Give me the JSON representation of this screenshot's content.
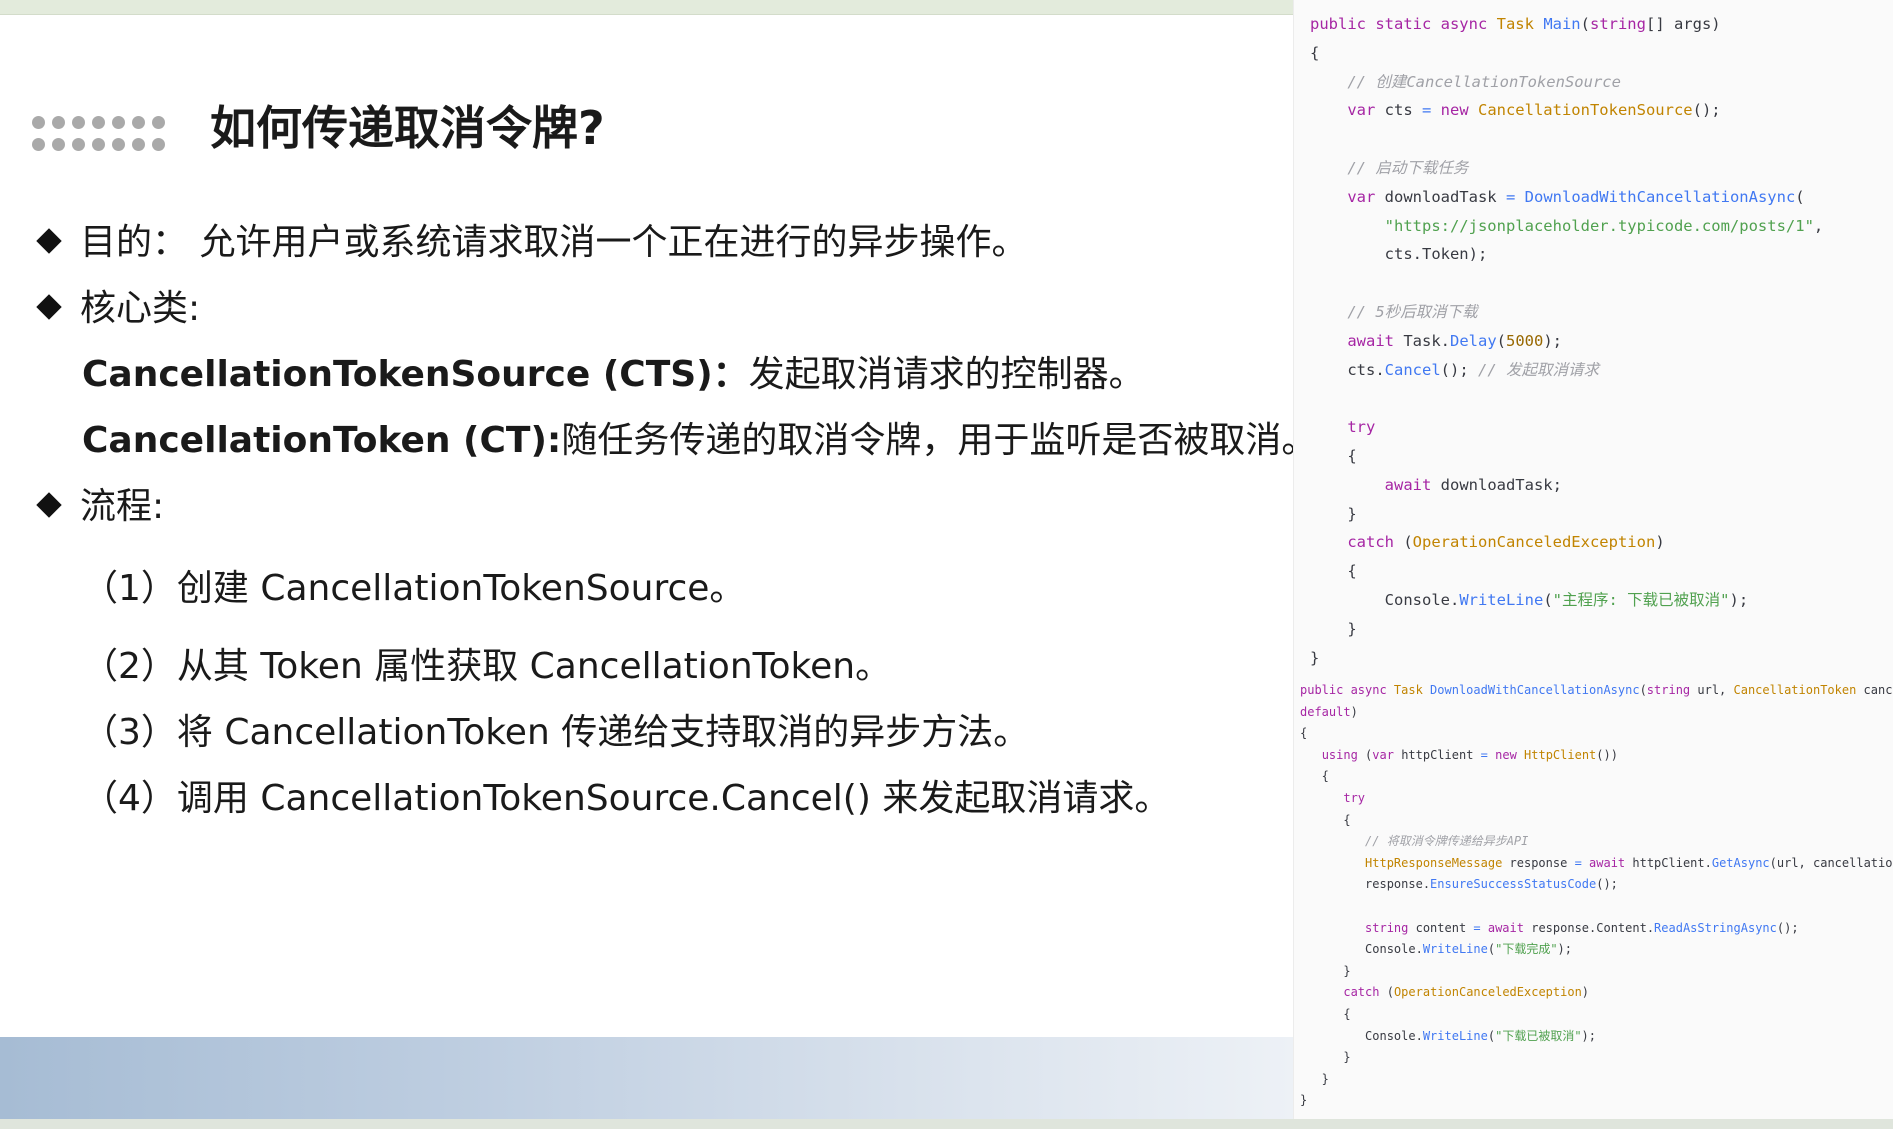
{
  "slide": {
    "title": "如何传递取消令牌?",
    "bullets": {
      "purpose": "目的： 允许用户或系统请求取消一个正在进行的异步操作。",
      "core_classes": "核心类:",
      "cts_term": "CancellationTokenSource (CTS)：",
      "cts_desc": "发起取消请求的控制器。",
      "ct_term": "CancellationToken (CT):",
      "ct_desc": "随任务传递的取消令牌，用于监听是否被取消。",
      "flow": "流程:"
    },
    "steps": [
      "（1）创建 CancellationTokenSource。",
      "（2）从其 Token 属性获取 CancellationToken。",
      "（3）将 CancellationToken 传递给支持取消的异步方法。",
      "（4）调用 CancellationTokenSource.Cancel() 来发起取消请求。"
    ]
  },
  "code": {
    "main": [
      [
        [
          "public static async ",
          "k"
        ],
        [
          "Task ",
          "t"
        ],
        [
          "Main",
          "f"
        ],
        [
          "(",
          "p"
        ],
        [
          "string",
          "k"
        ],
        [
          "[] args)",
          "p"
        ]
      ],
      [
        [
          "{",
          "p"
        ]
      ],
      [
        [
          "    // 创建CancellationTokenSource",
          "c"
        ]
      ],
      [
        [
          "    ",
          "p"
        ],
        [
          "var ",
          "k"
        ],
        [
          "cts ",
          "p"
        ],
        [
          "= ",
          "f"
        ],
        [
          "new ",
          "k"
        ],
        [
          "CancellationTokenSource",
          "t"
        ],
        [
          "();",
          "p"
        ]
      ],
      [],
      [
        [
          "    // 启动下载任务",
          "c"
        ]
      ],
      [
        [
          "    ",
          "p"
        ],
        [
          "var ",
          "k"
        ],
        [
          "downloadTask ",
          "p"
        ],
        [
          "= ",
          "f"
        ],
        [
          "DownloadWithCancellationAsync",
          "f"
        ],
        [
          "(",
          "p"
        ]
      ],
      [
        [
          "        ",
          "p"
        ],
        [
          "\"https://jsonplaceholder.typicode.com/posts/1\"",
          "s"
        ],
        [
          ",",
          "p"
        ]
      ],
      [
        [
          "        cts.Token);",
          "p"
        ]
      ],
      [],
      [
        [
          "    // 5秒后取消下载",
          "c"
        ]
      ],
      [
        [
          "    ",
          "p"
        ],
        [
          "await ",
          "k"
        ],
        [
          "Task.",
          "p"
        ],
        [
          "Delay",
          "f"
        ],
        [
          "(",
          "p"
        ],
        [
          "5000",
          "n"
        ],
        [
          ");",
          "p"
        ]
      ],
      [
        [
          "    cts.",
          "p"
        ],
        [
          "Cancel",
          "f"
        ],
        [
          "(); ",
          "p"
        ],
        [
          "// 发起取消请求",
          "c"
        ]
      ],
      [],
      [
        [
          "    ",
          "p"
        ],
        [
          "try",
          "k"
        ]
      ],
      [
        [
          "    {",
          "p"
        ]
      ],
      [
        [
          "        ",
          "p"
        ],
        [
          "await ",
          "k"
        ],
        [
          "downloadTask;",
          "p"
        ]
      ],
      [
        [
          "    }",
          "p"
        ]
      ],
      [
        [
          "    ",
          "p"
        ],
        [
          "catch ",
          "k"
        ],
        [
          "(",
          "p"
        ],
        [
          "OperationCanceledException",
          "t"
        ],
        [
          ")",
          "p"
        ]
      ],
      [
        [
          "    {",
          "p"
        ]
      ],
      [
        [
          "        Console.",
          "p"
        ],
        [
          "WriteLine",
          "f"
        ],
        [
          "(",
          "p"
        ],
        [
          "\"主程序: 下载已被取消\"",
          "s"
        ],
        [
          ");",
          "p"
        ]
      ],
      [
        [
          "    }",
          "p"
        ]
      ],
      [
        [
          "}",
          "p"
        ]
      ]
    ],
    "download": [
      [
        [
          "public async ",
          "k"
        ],
        [
          "Task ",
          "t"
        ],
        [
          "DownloadWithCancellationAsync",
          "f"
        ],
        [
          "(",
          "p"
        ],
        [
          "string ",
          "k"
        ],
        [
          "url, ",
          "p"
        ],
        [
          "CancellationToken ",
          "t"
        ],
        [
          "cancellationToken =",
          "p"
        ]
      ],
      [
        [
          "default",
          "k"
        ],
        [
          ")",
          "p"
        ]
      ],
      [
        [
          "{",
          "p"
        ]
      ],
      [
        [
          "   ",
          "p"
        ],
        [
          "using ",
          "k"
        ],
        [
          "(",
          "p"
        ],
        [
          "var ",
          "k"
        ],
        [
          "httpClient ",
          "p"
        ],
        [
          "= ",
          "f"
        ],
        [
          "new ",
          "k"
        ],
        [
          "HttpClient",
          "t"
        ],
        [
          "())",
          "p"
        ]
      ],
      [
        [
          "   {",
          "p"
        ]
      ],
      [
        [
          "      ",
          "p"
        ],
        [
          "try",
          "k"
        ]
      ],
      [
        [
          "      {",
          "p"
        ]
      ],
      [
        [
          "         // 将取消令牌传递给异步API",
          "c"
        ]
      ],
      [
        [
          "         ",
          "p"
        ],
        [
          "HttpResponseMessage ",
          "t"
        ],
        [
          "response ",
          "p"
        ],
        [
          "= ",
          "f"
        ],
        [
          "await ",
          "k"
        ],
        [
          "httpClient.",
          "p"
        ],
        [
          "GetAsync",
          "f"
        ],
        [
          "(url, cancellationToken);",
          "p"
        ]
      ],
      [
        [
          "         response.",
          "p"
        ],
        [
          "EnsureSuccessStatusCode",
          "f"
        ],
        [
          "();",
          "p"
        ]
      ],
      [],
      [
        [
          "         ",
          "p"
        ],
        [
          "string ",
          "k"
        ],
        [
          "content ",
          "p"
        ],
        [
          "= ",
          "f"
        ],
        [
          "await ",
          "k"
        ],
        [
          "response.Content.",
          "p"
        ],
        [
          "ReadAsStringAsync",
          "f"
        ],
        [
          "();",
          "p"
        ]
      ],
      [
        [
          "         Console.",
          "p"
        ],
        [
          "WriteLine",
          "f"
        ],
        [
          "(",
          "p"
        ],
        [
          "\"下载完成\"",
          "s"
        ],
        [
          ");",
          "p"
        ]
      ],
      [
        [
          "      }",
          "p"
        ]
      ],
      [
        [
          "      ",
          "p"
        ],
        [
          "catch ",
          "k"
        ],
        [
          "(",
          "p"
        ],
        [
          "OperationCanceledException",
          "t"
        ],
        [
          ")",
          "p"
        ]
      ],
      [
        [
          "      {",
          "p"
        ]
      ],
      [
        [
          "         Console.",
          "p"
        ],
        [
          "WriteLine",
          "f"
        ],
        [
          "(",
          "p"
        ],
        [
          "\"下载已被取消\"",
          "s"
        ],
        [
          ");",
          "p"
        ]
      ],
      [
        [
          "      }",
          "p"
        ]
      ],
      [
        [
          "   }",
          "p"
        ]
      ],
      [
        [
          "}",
          "p"
        ]
      ]
    ]
  }
}
